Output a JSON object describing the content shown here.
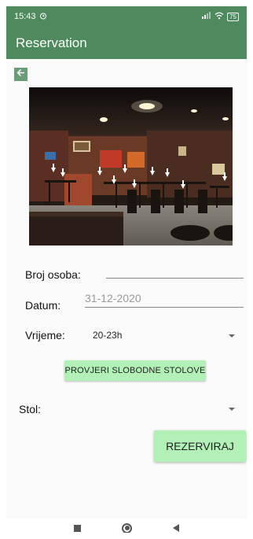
{
  "status_bar": {
    "time": "15:43",
    "battery": "75"
  },
  "app_bar": {
    "title": "Reservation"
  },
  "form": {
    "persons_label": "Broj osoba:",
    "persons_value": "",
    "date_label": "Datum:",
    "date_placeholder": "31-12-2020",
    "time_label": "Vrijeme:",
    "time_value": "20-23h",
    "check_button": "PROVJERI SLOBODNE STOLOVE",
    "table_label": "Stol:",
    "table_value": "",
    "reserve_button": "REZERVIRAJ"
  },
  "icons": {
    "back": "arrow-left-icon",
    "alarm": "alarm-icon",
    "signal": "signal-icon",
    "wifi": "wifi-icon",
    "battery": "battery-icon"
  },
  "colors": {
    "app_bar": "#4e8a5e",
    "button": "#b2f0b8"
  }
}
